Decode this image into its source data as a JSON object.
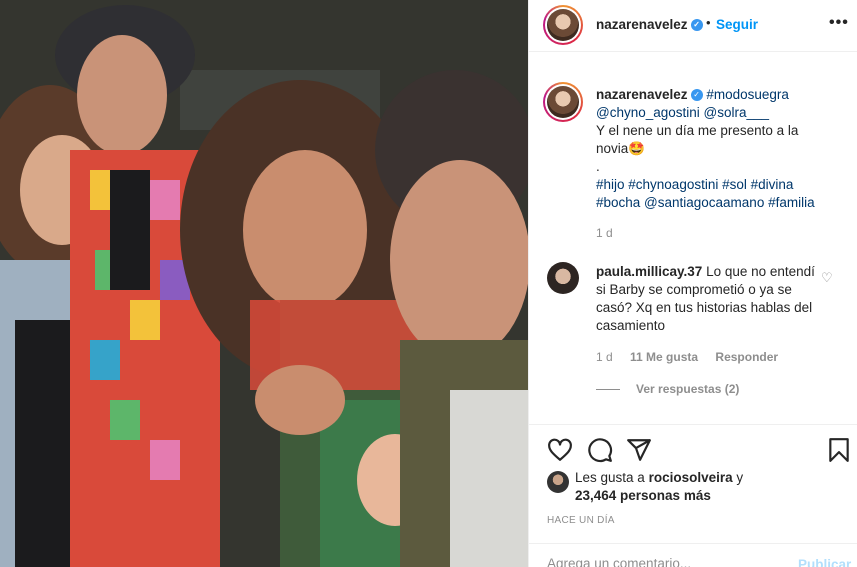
{
  "post": {
    "username": "nazarenavelez",
    "verified_mark": "✓",
    "dot": "•",
    "follow_label": "Seguir",
    "more_label": "•••"
  },
  "caption": {
    "username": "nazarenavelez",
    "hashtag_1": "#modosuegra",
    "mention_1": "@chyno_agostini",
    "mention_2": "@solra___",
    "line_1": "Y el nene un día me presento a la",
    "line_2": "novia🤩",
    "line_3": ".",
    "tags_line_1": "#hijo #chynoagostini #sol #divina",
    "tags_line_2": "#bocha @santiagocaamano #familia",
    "time": "1 d"
  },
  "comment": {
    "username": "paula.millicay.37",
    "text": "Lo que no entendí si Barby se comprometió o ya se casó? Xq en tus historias hablas del casamiento",
    "time": "1 d",
    "likes": "11 Me gusta",
    "reply_label": "Responder",
    "view_replies": "Ver respuestas (2)"
  },
  "likes": {
    "prefix": "Les gusta a",
    "liker": "rociosolveira",
    "conj": "y",
    "others": "23,464 personas más"
  },
  "posted_ago": "HACE UN DÍA",
  "add_comment": {
    "placeholder": "Agrega un comentario...",
    "post_label": "Publicar"
  },
  "colors": {
    "accent": "#0095f6",
    "link": "#00376b",
    "muted": "#8e8e8e"
  },
  "icons": [
    "heart-icon",
    "comment-icon",
    "share-icon",
    "bookmark-icon",
    "more-icon",
    "verified-icon"
  ]
}
